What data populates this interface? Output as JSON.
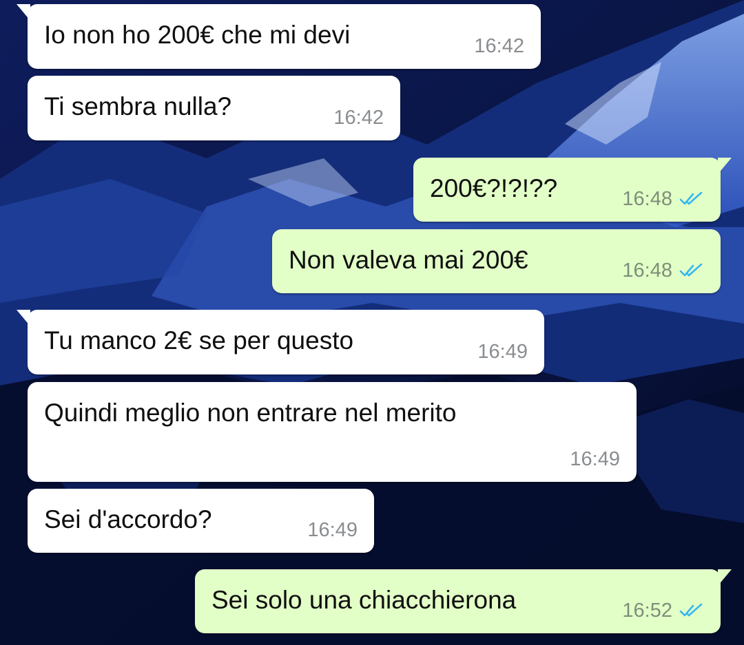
{
  "theme": {
    "incoming_bubble_color": "#ffffff",
    "outgoing_bubble_color": "#e2ffc7",
    "read_tick_color": "#34b7f1",
    "wallpaper": "dark blue snowy mountain night"
  },
  "messages": [
    {
      "direction": "incoming",
      "text": "Io non ho 200€ che mi devi",
      "time": "16:42"
    },
    {
      "direction": "incoming",
      "text": "Ti sembra nulla?",
      "time": "16:42"
    },
    {
      "direction": "outgoing",
      "text": "200€?!?!??",
      "time": "16:48",
      "status": "read",
      "status_icon": "double-check-icon"
    },
    {
      "direction": "outgoing",
      "text": "Non valeva mai 200€",
      "time": "16:48",
      "status": "read",
      "status_icon": "double-check-icon"
    },
    {
      "direction": "incoming",
      "text": "Tu manco 2€ se per questo",
      "time": "16:49"
    },
    {
      "direction": "incoming",
      "text": "Quindi meglio non entrare nel merito",
      "time": "16:49"
    },
    {
      "direction": "incoming",
      "text": "Sei d'accordo?",
      "time": "16:49"
    },
    {
      "direction": "outgoing",
      "text": "Sei solo una chiacchierona",
      "time": "16:52",
      "status": "read",
      "status_icon": "double-check-icon"
    }
  ]
}
